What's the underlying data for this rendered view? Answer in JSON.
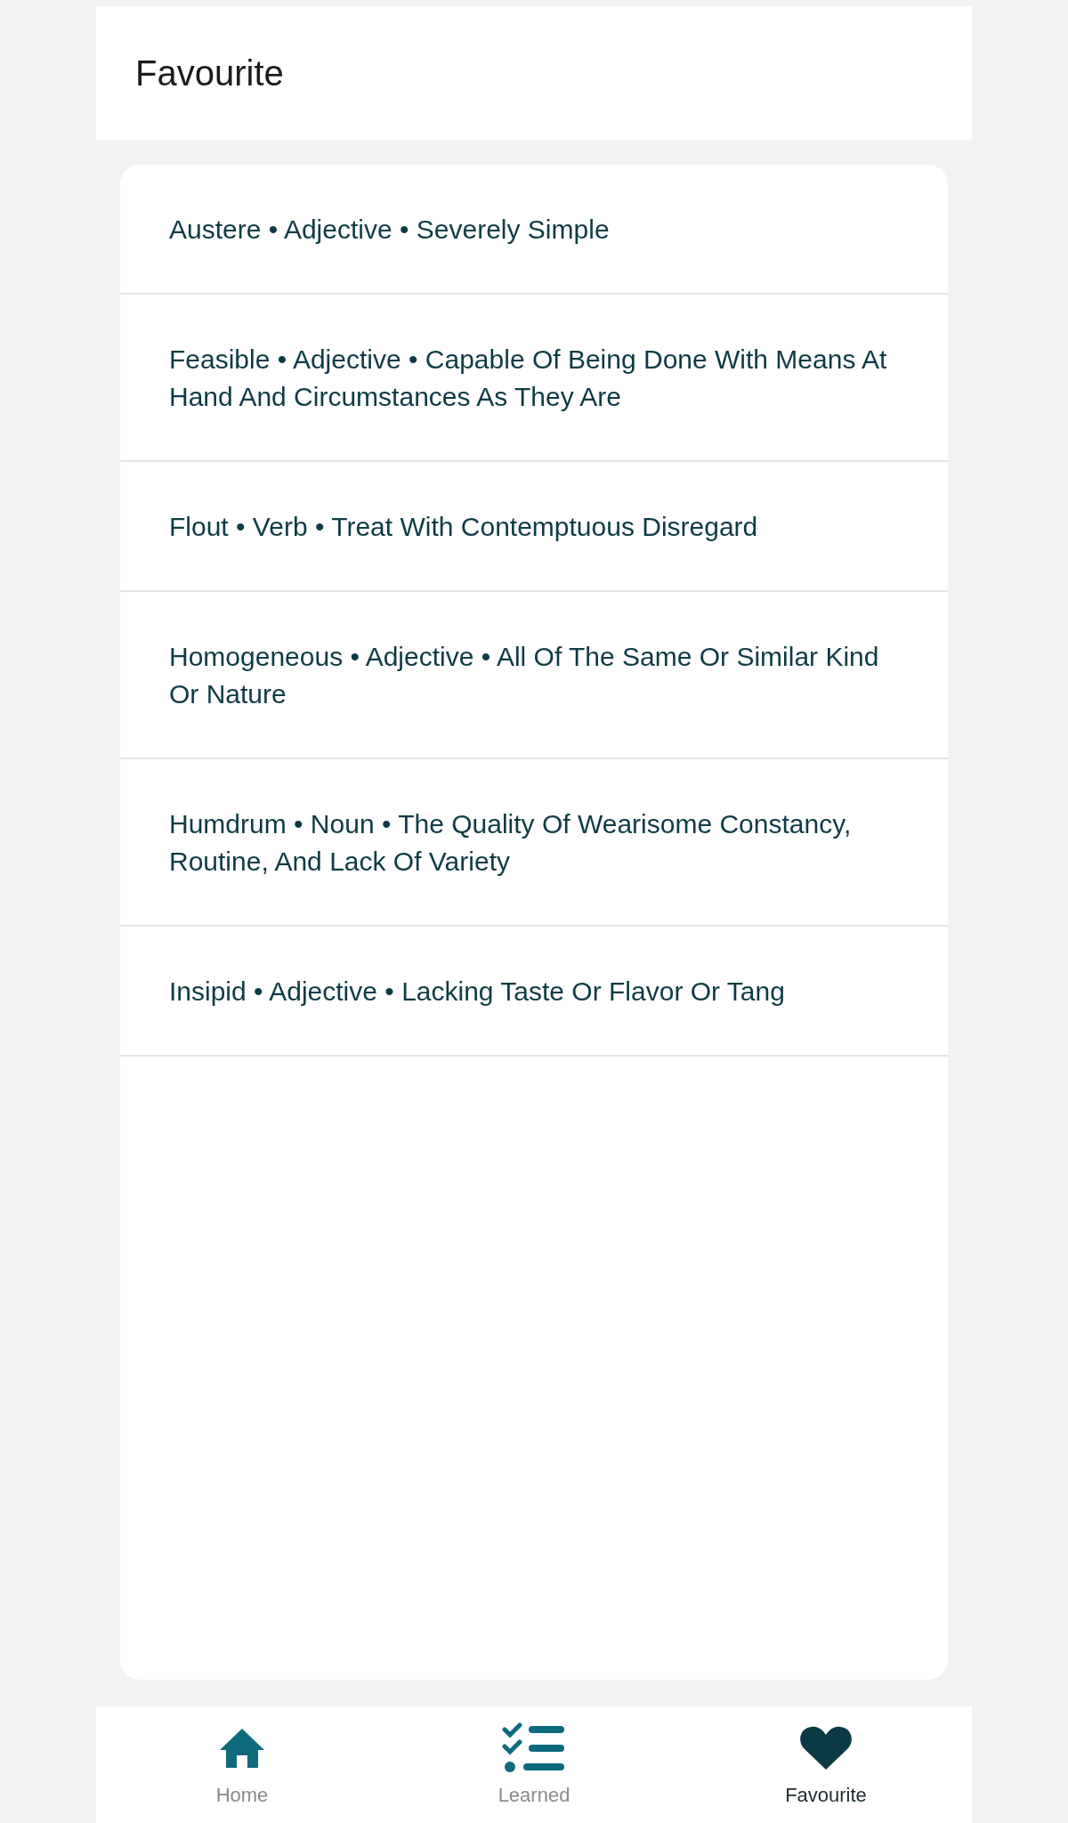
{
  "header": {
    "title": "Favourite"
  },
  "entries": [
    {
      "text": "Austere • Adjective • Severely Simple"
    },
    {
      "text": "Feasible • Adjective • Capable Of Being Done With Means At Hand And Circumstances As They Are"
    },
    {
      "text": "Flout • Verb • Treat With Contemptuous Disregard"
    },
    {
      "text": "Homogeneous • Adjective • All Of The Same Or Similar Kind Or Nature"
    },
    {
      "text": "Humdrum • Noun • The Quality Of Wearisome Constancy, Routine, And Lack Of Variety"
    },
    {
      "text": "Insipid • Adjective • Lacking Taste Or Flavor Or Tang"
    }
  ],
  "bottom_nav": [
    {
      "kind": "home",
      "label": "Home",
      "selected": false
    },
    {
      "kind": "learned",
      "label": "Learned",
      "selected": false
    },
    {
      "kind": "favourite",
      "label": "Favourite",
      "selected": true
    }
  ]
}
